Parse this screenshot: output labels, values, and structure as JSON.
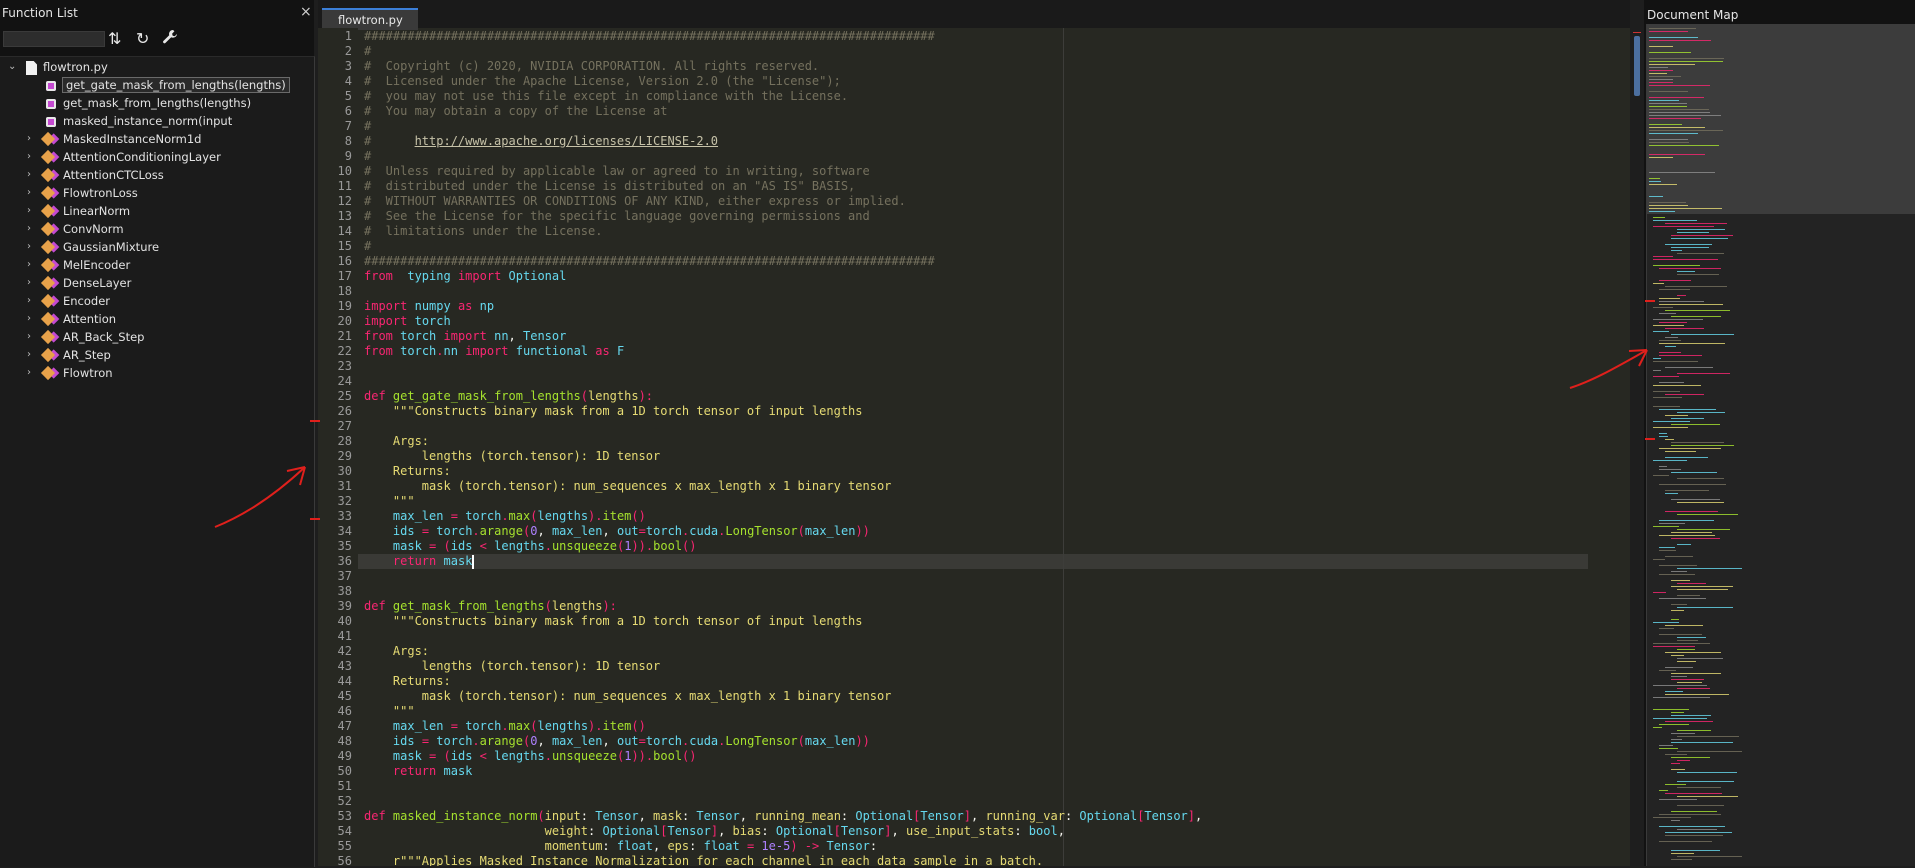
{
  "function_list": {
    "title": "Function List",
    "close_glyph": "×",
    "search_value": "",
    "toolbar_icons": [
      "sort-alpha-icon",
      "refresh-icon",
      "wrench-icon"
    ],
    "tree": [
      {
        "label": "flowtron.py",
        "kind": "file",
        "expanded": true
      },
      {
        "label": "get_gate_mask_from_lengths(lengths)",
        "kind": "function",
        "selected": true
      },
      {
        "label": "get_mask_from_lengths(lengths)",
        "kind": "function"
      },
      {
        "label": "masked_instance_norm(input",
        "kind": "function"
      },
      {
        "label": "MaskedInstanceNorm1d",
        "kind": "class"
      },
      {
        "label": "AttentionConditioningLayer",
        "kind": "class"
      },
      {
        "label": "AttentionCTCLoss",
        "kind": "class"
      },
      {
        "label": "FlowtronLoss",
        "kind": "class"
      },
      {
        "label": "LinearNorm",
        "kind": "class"
      },
      {
        "label": "ConvNorm",
        "kind": "class"
      },
      {
        "label": "GaussianMixture",
        "kind": "class"
      },
      {
        "label": "MelEncoder",
        "kind": "class"
      },
      {
        "label": "DenseLayer",
        "kind": "class"
      },
      {
        "label": "Encoder",
        "kind": "class"
      },
      {
        "label": "Attention",
        "kind": "class"
      },
      {
        "label": "AR_Back_Step",
        "kind": "class"
      },
      {
        "label": "AR_Step",
        "kind": "class"
      },
      {
        "label": "Flowtron",
        "kind": "class"
      }
    ]
  },
  "editor": {
    "tab_label": "flowtron.py",
    "current_line": 36,
    "lines": [
      [
        [
          "c",
          "###############################################################################"
        ]
      ],
      [
        [
          "c",
          "#"
        ]
      ],
      [
        [
          "c",
          "#  Copyright (c) 2020, NVIDIA CORPORATION. All rights reserved."
        ]
      ],
      [
        [
          "c",
          "#  Licensed under the Apache License, Version 2.0 (the \"License\");"
        ]
      ],
      [
        [
          "c",
          "#  you may not use this file except in compliance with the License."
        ]
      ],
      [
        [
          "c",
          "#  You may obtain a copy of the License at"
        ]
      ],
      [
        [
          "c",
          "#"
        ]
      ],
      [
        [
          "c",
          "#      "
        ],
        [
          "u",
          "http://www.apache.org/licenses/LICENSE-2.0"
        ]
      ],
      [
        [
          "c",
          "#"
        ]
      ],
      [
        [
          "c",
          "#  Unless required by applicable law or agreed to in writing, software"
        ]
      ],
      [
        [
          "c",
          "#  distributed under the License is distributed on an \"AS IS\" BASIS,"
        ]
      ],
      [
        [
          "c",
          "#  WITHOUT WARRANTIES OR CONDITIONS OF ANY KIND, either express or implied."
        ]
      ],
      [
        [
          "c",
          "#  See the License for the specific language governing permissions and"
        ]
      ],
      [
        [
          "c",
          "#  limitations under the License."
        ]
      ],
      [
        [
          "c",
          "#"
        ]
      ],
      [
        [
          "c",
          "###############################################################################"
        ]
      ],
      [
        [
          "k",
          "from"
        ],
        [
          "",
          "  "
        ],
        [
          "b",
          "typing"
        ],
        [
          "",
          " "
        ],
        [
          "k",
          "import"
        ],
        [
          "",
          " "
        ],
        [
          "b",
          "Optional"
        ]
      ],
      [],
      [
        [
          "k",
          "import"
        ],
        [
          "",
          " "
        ],
        [
          "b",
          "numpy"
        ],
        [
          "",
          " "
        ],
        [
          "k",
          "as"
        ],
        [
          "",
          " "
        ],
        [
          "b",
          "np"
        ]
      ],
      [
        [
          "k",
          "import"
        ],
        [
          "",
          " "
        ],
        [
          "b",
          "torch"
        ]
      ],
      [
        [
          "k",
          "from"
        ],
        [
          "",
          " "
        ],
        [
          "b",
          "torch"
        ],
        [
          "",
          " "
        ],
        [
          "k",
          "import"
        ],
        [
          "",
          " "
        ],
        [
          "b",
          "nn"
        ],
        [
          "",
          ", "
        ],
        [
          "b",
          "Tensor"
        ]
      ],
      [
        [
          "k",
          "from"
        ],
        [
          "",
          " "
        ],
        [
          "b",
          "torch"
        ],
        [
          "k",
          "."
        ],
        [
          "b",
          "nn"
        ],
        [
          "",
          " "
        ],
        [
          "k",
          "import"
        ],
        [
          "",
          " "
        ],
        [
          "b",
          "functional"
        ],
        [
          "",
          " "
        ],
        [
          "k",
          "as"
        ],
        [
          "",
          " "
        ],
        [
          "b",
          "F"
        ]
      ],
      [],
      [],
      [
        [
          "k",
          "def"
        ],
        [
          "",
          " "
        ],
        [
          "f",
          "get_gate_mask_from_lengths"
        ],
        [
          "k",
          "("
        ],
        [
          "s",
          "lengths"
        ],
        [
          "k",
          "):"
        ]
      ],
      [
        [
          "",
          "    "
        ],
        [
          "s",
          "\"\"\"Constructs binary mask from a 1D torch tensor of input lengths"
        ]
      ],
      [],
      [
        [
          "",
          "    "
        ],
        [
          "s",
          "Args:"
        ]
      ],
      [
        [
          "",
          "        "
        ],
        [
          "s",
          "lengths (torch.tensor): 1D tensor"
        ]
      ],
      [
        [
          "",
          "    "
        ],
        [
          "s",
          "Returns:"
        ]
      ],
      [
        [
          "",
          "        "
        ],
        [
          "s",
          "mask (torch.tensor): num_sequences x max_length x 1 binary tensor"
        ]
      ],
      [
        [
          "",
          "    "
        ],
        [
          "s",
          "\"\"\""
        ]
      ],
      [
        [
          "",
          "    "
        ],
        [
          "b",
          "max_len"
        ],
        [
          "",
          " "
        ],
        [
          "k",
          "="
        ],
        [
          "",
          " "
        ],
        [
          "b",
          "torch"
        ],
        [
          "k",
          "."
        ],
        [
          "f",
          "max"
        ],
        [
          "k",
          "("
        ],
        [
          "b",
          "lengths"
        ],
        [
          "k",
          ")."
        ],
        [
          "f",
          "item"
        ],
        [
          "k",
          "()"
        ]
      ],
      [
        [
          "",
          "    "
        ],
        [
          "b",
          "ids"
        ],
        [
          "",
          " "
        ],
        [
          "k",
          "="
        ],
        [
          "",
          " "
        ],
        [
          "b",
          "torch"
        ],
        [
          "k",
          "."
        ],
        [
          "f",
          "arange"
        ],
        [
          "k",
          "("
        ],
        [
          "n",
          "0"
        ],
        [
          "",
          ", "
        ],
        [
          "b",
          "max_len"
        ],
        [
          "",
          ", "
        ],
        [
          "b",
          "out"
        ],
        [
          "k",
          "="
        ],
        [
          "b",
          "torch"
        ],
        [
          "k",
          "."
        ],
        [
          "b",
          "cuda"
        ],
        [
          "k",
          "."
        ],
        [
          "f",
          "LongTensor"
        ],
        [
          "k",
          "("
        ],
        [
          "b",
          "max_len"
        ],
        [
          "k",
          "))"
        ]
      ],
      [
        [
          "",
          "    "
        ],
        [
          "b",
          "mask"
        ],
        [
          "",
          " "
        ],
        [
          "k",
          "="
        ],
        [
          "",
          " "
        ],
        [
          "k",
          "("
        ],
        [
          "b",
          "ids"
        ],
        [
          "",
          " "
        ],
        [
          "k",
          "<"
        ],
        [
          "",
          " "
        ],
        [
          "b",
          "lengths"
        ],
        [
          "k",
          "."
        ],
        [
          "f",
          "unsqueeze"
        ],
        [
          "k",
          "("
        ],
        [
          "n",
          "1"
        ],
        [
          "k",
          "))."
        ],
        [
          "f",
          "bool"
        ],
        [
          "k",
          "()"
        ]
      ],
      [
        [
          "",
          "    "
        ],
        [
          "k",
          "return"
        ],
        [
          "",
          " "
        ],
        [
          "b",
          "mask"
        ]
      ],
      [],
      [],
      [
        [
          "k",
          "def"
        ],
        [
          "",
          " "
        ],
        [
          "f",
          "get_mask_from_lengths"
        ],
        [
          "k",
          "("
        ],
        [
          "s",
          "lengths"
        ],
        [
          "k",
          "):"
        ]
      ],
      [
        [
          "",
          "    "
        ],
        [
          "s",
          "\"\"\"Constructs binary mask from a 1D torch tensor of input lengths"
        ]
      ],
      [],
      [
        [
          "",
          "    "
        ],
        [
          "s",
          "Args:"
        ]
      ],
      [
        [
          "",
          "        "
        ],
        [
          "s",
          "lengths (torch.tensor): 1D tensor"
        ]
      ],
      [
        [
          "",
          "    "
        ],
        [
          "s",
          "Returns:"
        ]
      ],
      [
        [
          "",
          "        "
        ],
        [
          "s",
          "mask (torch.tensor): num_sequences x max_length x 1 binary tensor"
        ]
      ],
      [
        [
          "",
          "    "
        ],
        [
          "s",
          "\"\"\""
        ]
      ],
      [
        [
          "",
          "    "
        ],
        [
          "b",
          "max_len"
        ],
        [
          "",
          " "
        ],
        [
          "k",
          "="
        ],
        [
          "",
          " "
        ],
        [
          "b",
          "torch"
        ],
        [
          "k",
          "."
        ],
        [
          "f",
          "max"
        ],
        [
          "k",
          "("
        ],
        [
          "b",
          "lengths"
        ],
        [
          "k",
          ")."
        ],
        [
          "f",
          "item"
        ],
        [
          "k",
          "()"
        ]
      ],
      [
        [
          "",
          "    "
        ],
        [
          "b",
          "ids"
        ],
        [
          "",
          " "
        ],
        [
          "k",
          "="
        ],
        [
          "",
          " "
        ],
        [
          "b",
          "torch"
        ],
        [
          "k",
          "."
        ],
        [
          "f",
          "arange"
        ],
        [
          "k",
          "("
        ],
        [
          "n",
          "0"
        ],
        [
          "",
          ", "
        ],
        [
          "b",
          "max_len"
        ],
        [
          "",
          ", "
        ],
        [
          "b",
          "out"
        ],
        [
          "k",
          "="
        ],
        [
          "b",
          "torch"
        ],
        [
          "k",
          "."
        ],
        [
          "b",
          "cuda"
        ],
        [
          "k",
          "."
        ],
        [
          "f",
          "LongTensor"
        ],
        [
          "k",
          "("
        ],
        [
          "b",
          "max_len"
        ],
        [
          "k",
          "))"
        ]
      ],
      [
        [
          "",
          "    "
        ],
        [
          "b",
          "mask"
        ],
        [
          "",
          " "
        ],
        [
          "k",
          "="
        ],
        [
          "",
          " "
        ],
        [
          "k",
          "("
        ],
        [
          "b",
          "ids"
        ],
        [
          "",
          " "
        ],
        [
          "k",
          "<"
        ],
        [
          "",
          " "
        ],
        [
          "b",
          "lengths"
        ],
        [
          "k",
          "."
        ],
        [
          "f",
          "unsqueeze"
        ],
        [
          "k",
          "("
        ],
        [
          "n",
          "1"
        ],
        [
          "k",
          "))."
        ],
        [
          "f",
          "bool"
        ],
        [
          "k",
          "()"
        ]
      ],
      [
        [
          "",
          "    "
        ],
        [
          "k",
          "return"
        ],
        [
          "",
          " "
        ],
        [
          "b",
          "mask"
        ]
      ],
      [],
      [],
      [
        [
          "k",
          "def"
        ],
        [
          "",
          " "
        ],
        [
          "f",
          "masked_instance_norm"
        ],
        [
          "k",
          "("
        ],
        [
          "s",
          "input"
        ],
        [
          "",
          ": "
        ],
        [
          "b",
          "Tensor"
        ],
        [
          "",
          ", "
        ],
        [
          "s",
          "mask"
        ],
        [
          "",
          ": "
        ],
        [
          "b",
          "Tensor"
        ],
        [
          "",
          ", "
        ],
        [
          "s",
          "running_mean"
        ],
        [
          "",
          ": "
        ],
        [
          "b",
          "Optional"
        ],
        [
          "k",
          "["
        ],
        [
          "b",
          "Tensor"
        ],
        [
          "k",
          "]"
        ],
        [
          "",
          ", "
        ],
        [
          "s",
          "running_var"
        ],
        [
          "",
          ": "
        ],
        [
          "b",
          "Optional"
        ],
        [
          "k",
          "["
        ],
        [
          "b",
          "Tensor"
        ],
        [
          "k",
          "]"
        ],
        [
          "",
          ","
        ]
      ],
      [
        [
          "",
          "                         "
        ],
        [
          "s",
          "weight"
        ],
        [
          "",
          ": "
        ],
        [
          "b",
          "Optional"
        ],
        [
          "k",
          "["
        ],
        [
          "b",
          "Tensor"
        ],
        [
          "k",
          "]"
        ],
        [
          "",
          ", "
        ],
        [
          "s",
          "bias"
        ],
        [
          "",
          ": "
        ],
        [
          "b",
          "Optional"
        ],
        [
          "k",
          "["
        ],
        [
          "b",
          "Tensor"
        ],
        [
          "k",
          "]"
        ],
        [
          "",
          ", "
        ],
        [
          "s",
          "use_input_stats"
        ],
        [
          "",
          ": "
        ],
        [
          "b",
          "bool"
        ],
        [
          "",
          ","
        ]
      ],
      [
        [
          "",
          "                         "
        ],
        [
          "s",
          "momentum"
        ],
        [
          "",
          ": "
        ],
        [
          "b",
          "float"
        ],
        [
          "",
          ", "
        ],
        [
          "s",
          "eps"
        ],
        [
          "",
          ": "
        ],
        [
          "b",
          "float"
        ],
        [
          "",
          " "
        ],
        [
          "k",
          "="
        ],
        [
          "",
          " "
        ],
        [
          "n",
          "1e-5"
        ],
        [
          "k",
          ")"
        ],
        [
          "",
          " "
        ],
        [
          "k",
          "->"
        ],
        [
          "",
          " "
        ],
        [
          "b",
          "Tensor"
        ],
        [
          "",
          ":"
        ]
      ],
      [
        [
          "",
          "    "
        ],
        [
          "s",
          "r\"\"\"Applies Masked Instance Normalization for each channel in each data sample in a batch."
        ]
      ]
    ]
  },
  "document_map": {
    "title": "Document Map"
  },
  "colors": {
    "comment": "#75715e",
    "keyword": "#f92672",
    "function": "#a6e22e",
    "builtin": "#66d9ef",
    "string": "#e6db74",
    "number": "#ae81ff",
    "annotation": "#e0201c",
    "tab_accent": "#3c7fd8"
  }
}
